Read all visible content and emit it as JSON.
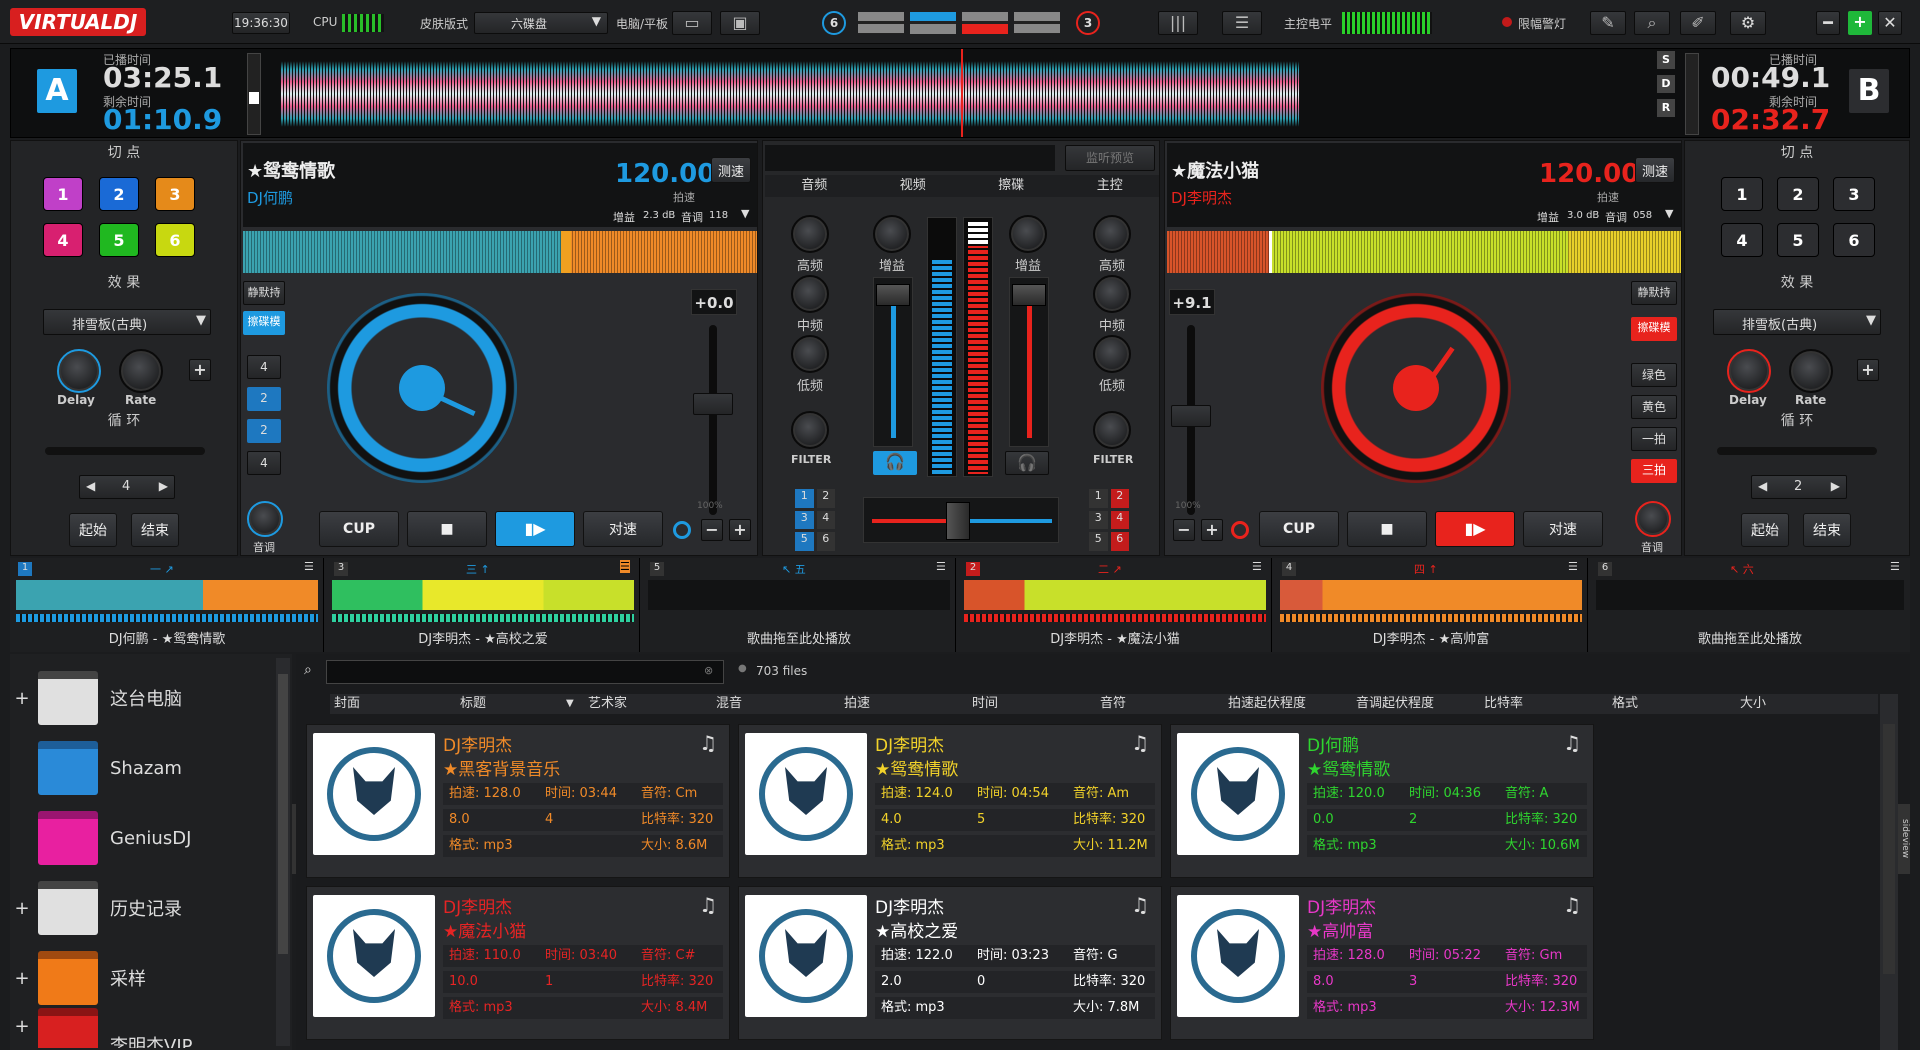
{
  "topbar": {
    "logo": "VIRTUALDJ",
    "time": "19:36:30",
    "cpu": "CPU",
    "skin_label": "皮肤版式",
    "skin_value": "六碟盘",
    "device_label": "电脑/平板",
    "left_deck_count": "6",
    "right_deck_count": "3",
    "master_level": "主控电平",
    "limiter": "限幅警灯"
  },
  "decks": {
    "a": {
      "letter": "A",
      "elapsed_label": "已播时间",
      "elapsed": "03:25.1",
      "remain_label": "剩余时间",
      "remain": "01:10.9",
      "title": "★鸳鸯情歌",
      "artist": "DJ何鹏",
      "bpm": "120.00",
      "bpm_label": "拍速",
      "tap": "测速",
      "gain": "增益",
      "gain_val": "2.3 dB",
      "key_label": "音调",
      "key_val": "118",
      "pitch": "+0.0",
      "pitch_pct": "100%",
      "btn_cup": "CUP",
      "btn_sync": "对速",
      "volume": "音调",
      "sel": "静默持",
      "sel2": "擦碟模",
      "pads": [
        "4",
        "2",
        "2",
        "4"
      ]
    },
    "b": {
      "letter": "B",
      "elapsed_label": "已播时间",
      "elapsed": "00:49.1",
      "remain_label": "剩余时间",
      "remain": "02:32.7",
      "title": "★魔法小猫",
      "artist": "DJ李明杰",
      "bpm": "120.00",
      "bpm_label": "拍速",
      "tap": "测速",
      "gain": "增益",
      "gain_val": "3.0 dB",
      "key_label": "音调",
      "key_val": "058",
      "pitch": "+9.1",
      "pitch_pct": "100%",
      "btn_cup": "CUP",
      "btn_sync": "对速",
      "volume": "音调",
      "sel": "静默持",
      "sel2": "擦碟模",
      "side": [
        "绿色",
        "黄色",
        "一拍",
        "三拍"
      ]
    }
  },
  "leftpanel": {
    "cue": "切 点",
    "pads": [
      "1",
      "2",
      "3",
      "4",
      "5",
      "6"
    ],
    "fx": "效 果",
    "fx_sel": "排雪板(古典)",
    "delay": "Delay",
    "rate": "Rate",
    "loop": "循 环",
    "loop_val": "4",
    "start": "起始",
    "end": "结束"
  },
  "rightpanel": {
    "cue": "切 点",
    "pads": [
      "1",
      "2",
      "3",
      "4",
      "5",
      "6"
    ],
    "fx": "效 果",
    "fx_sel": "排雪板(古典)",
    "delay": "Delay",
    "rate": "Rate",
    "loop": "循 环",
    "loop_val": "2",
    "start": "起始",
    "end": "结束"
  },
  "mixer": {
    "monitor": "监听预览",
    "tabs": [
      "音频",
      "视频",
      "擦碟",
      "主控"
    ],
    "hi": "高频",
    "mid": "中频",
    "low": "低频",
    "filter": "FILTER",
    "gain": "增益"
  },
  "minidecks": [
    {
      "num": "1",
      "tag": "一 ↗",
      "name": "DJ何鹏 - ★鸳鸯情歌"
    },
    {
      "num": "3",
      "tag": "三 ↑",
      "name": "DJ李明杰 - ★高校之爱"
    },
    {
      "num": "5",
      "tag": "↖ 五",
      "name": "歌曲拖至此处播放"
    },
    {
      "num": "2",
      "tag": "二 ↗",
      "name": "DJ李明杰 - ★魔法小猫"
    },
    {
      "num": "4",
      "tag": "四 ↑",
      "name": "DJ李明杰 - ★高帅富"
    },
    {
      "num": "6",
      "tag": "↖ 六",
      "name": "歌曲拖至此处播放"
    }
  ],
  "browser": {
    "folders": [
      "这台电脑",
      "Shazam",
      "GeniusDJ",
      "历史记录",
      "采样",
      "李明杰VIP"
    ],
    "folders_tab": "folders",
    "sideview_tab": "sideview",
    "files": "703 files",
    "columns": [
      "封面",
      "标题",
      "艺术家",
      "混音",
      "拍速",
      "时间",
      "音符",
      "拍速起伏程度",
      "音调起伏程度",
      "比特率",
      "格式",
      "大小"
    ],
    "cards": [
      {
        "artist": "DJ李明杰",
        "title": "★黑客背景音乐",
        "bpm": "拍速: 128.0",
        "time": "时间: 03:44",
        "key": "音符: Cm",
        "v1": "8.0",
        "v2": "4",
        "bitrate": "比特率: 320",
        "format": "格式: mp3",
        "size": "大小: 8.6M",
        "color": "#f08a28"
      },
      {
        "artist": "DJ李明杰",
        "title": "★鸳鸯情歌",
        "bpm": "拍速: 124.0",
        "time": "时间: 04:54",
        "key": "音符: Am",
        "v1": "4.0",
        "v2": "5",
        "bitrate": "比特率: 320",
        "format": "格式: mp3",
        "size": "大小: 11.2M",
        "color": "#f2d22a"
      },
      {
        "artist": "DJ何鹏",
        "title": "★鸳鸯情歌",
        "bpm": "拍速: 120.0",
        "time": "时间: 04:36",
        "key": "音符: A",
        "v1": "0.0",
        "v2": "2",
        "bitrate": "比特率: 320",
        "format": "格式: mp3",
        "size": "大小: 10.6M",
        "color": "#2fd52f"
      },
      {
        "artist": "DJ李明杰",
        "title": "★魔法小猫",
        "bpm": "拍速: 110.0",
        "time": "时间: 03:40",
        "key": "音符: C#",
        "v1": "10.0",
        "v2": "1",
        "bitrate": "比特率: 320",
        "format": "格式: mp3",
        "size": "大小: 8.4M",
        "color": "#e52424"
      },
      {
        "artist": "DJ李明杰",
        "title": "★高校之爱",
        "bpm": "拍速: 122.0",
        "time": "时间: 03:23",
        "key": "音符: G",
        "v1": "2.0",
        "v2": "0",
        "bitrate": "比特率: 320",
        "format": "格式: mp3",
        "size": "大小: 7.8M",
        "color": "#ffffff"
      },
      {
        "artist": "DJ李明杰",
        "title": "★高帅富",
        "bpm": "拍速: 128.0",
        "time": "时间: 05:22",
        "key": "音符: Gm",
        "v1": "8.0",
        "v2": "3",
        "bitrate": "比特率: 320",
        "format": "格式: mp3",
        "size": "大小: 12.3M",
        "color": "#e838c8"
      }
    ]
  },
  "colors": {
    "deck_a": "#1e9ae0",
    "deck_b": "#e8231d",
    "accent": "#f08a28"
  }
}
